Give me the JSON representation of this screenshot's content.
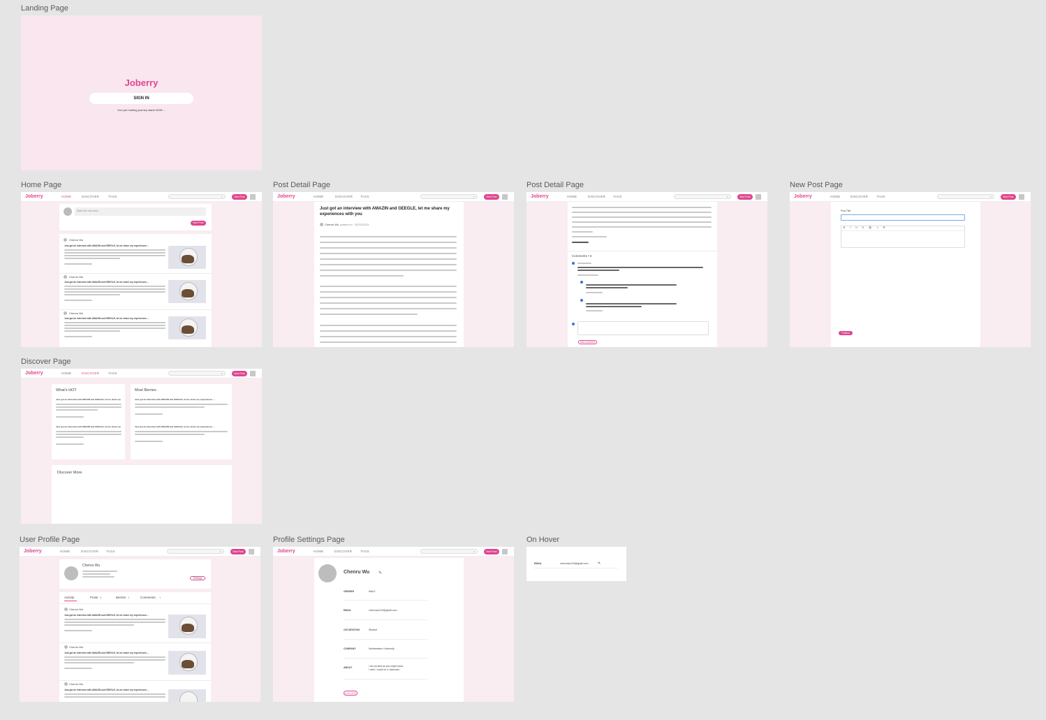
{
  "app": {
    "brand": "Joberry"
  },
  "frames": {
    "landing": "Landing Page",
    "home": "Home Page",
    "detail1": "Post Detail Page",
    "detail2": "Post Detail Page",
    "newpost": "New Post Page",
    "discover": "Discover Page",
    "profile": "User Profile Page",
    "settings": "Profile Settings Page",
    "hover": "On Hover"
  },
  "nav": {
    "home": "HOME",
    "discover": "DISCOVER",
    "tags": "TAGS",
    "new_post": "New Post"
  },
  "landing": {
    "sign_in": "SIGN IN",
    "tagline": "Your job hunting journey starts NOW ..."
  },
  "home": {
    "composer_placeholder": "Start new new here...",
    "post_button": "New Post"
  },
  "post": {
    "author": "Chenru Wu",
    "title_short": "Just got an interview with AMAZIN and GEEGLE, let me share my experiences ...",
    "title": "Just got an interview with AMAZIN and GEEGLE, let me share my experiences with you",
    "posted_on": "posted on",
    "date": "02/21/2023"
  },
  "comments": {
    "heading": "Comments • 5",
    "add_button": "Add comment"
  },
  "newpost": {
    "title_label": "Post Title",
    "publish": "Publish"
  },
  "discover": {
    "hot": "What's HOT",
    "berries": "Most Berries",
    "more": "Discover More",
    "hot_title": "Just got an interview with AMAZIN and GEEGLE, let me share my",
    "hot_title2": "Just got an interview with AMAZIN and GEEGLE, let me share my",
    "berries_title": "Just got an interview with AMAZIN and GEEGLE, let me share my experiences ..."
  },
  "profile": {
    "name": "Chenru Wu",
    "settings_btn": "Settings",
    "tabs": [
      "Activity",
      "Posts",
      "Berries",
      "Comments"
    ],
    "tab_counts": [
      "",
      "3",
      "1",
      "1"
    ]
  },
  "settings": {
    "name": "Chenru  Wu",
    "fields": [
      {
        "label": "GENDER",
        "value": "MALE"
      },
      {
        "label": "EMAIL",
        "value": "chenruwu123@gmail.com"
      },
      {
        "label": "OCCUPATION",
        "value": "Student"
      },
      {
        "label": "COMPANY",
        "value": "Northeastern University"
      },
      {
        "label": "ABOUT",
        "value": "I am an idiot as you might know.\nI wish I could be a Joberrian."
      }
    ],
    "logout": "LOG OUT"
  },
  "hover": {
    "label": "EMAIL",
    "value": "chenruwu123@gmail.com"
  },
  "colors": {
    "accent": "#e0458f",
    "frame_bg": "#f9edf2",
    "canvas_bg": "#e5e5e5"
  }
}
